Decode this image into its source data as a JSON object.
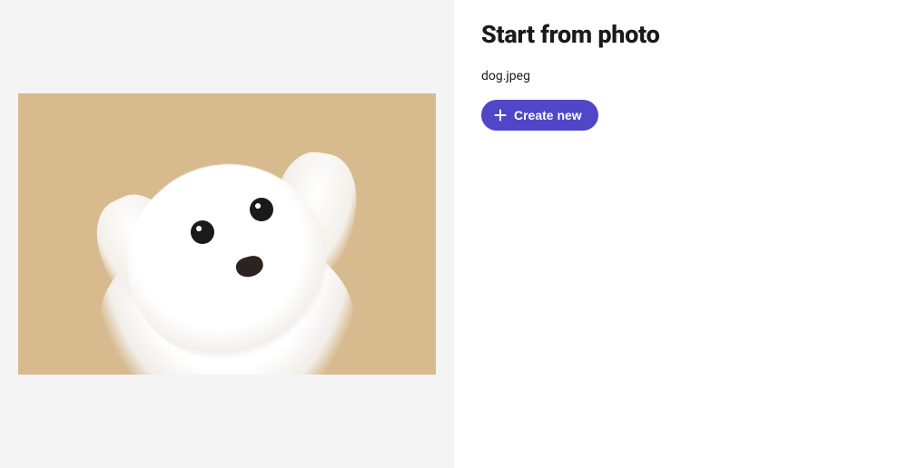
{
  "heading": "Start from photo",
  "filename": "dog.jpeg",
  "create_button": {
    "label": "Create new"
  },
  "colors": {
    "accent": "#4f46c8",
    "annotation": "#e77b2c"
  }
}
